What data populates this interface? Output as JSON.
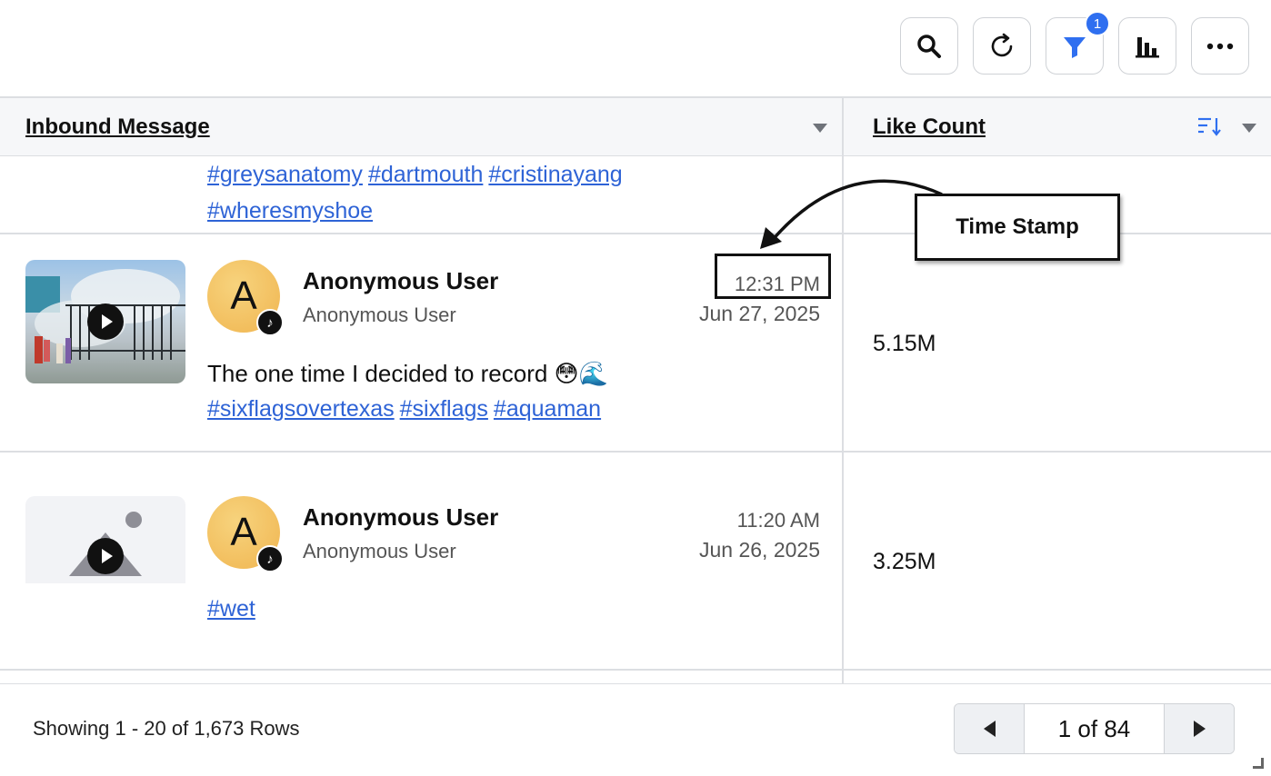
{
  "toolbar": {
    "filter_badge": "1",
    "buttons": [
      "search-icon",
      "refresh-icon",
      "filter-icon",
      "bar-chart-icon",
      "more-icon"
    ]
  },
  "columns": {
    "message": "Inbound Message",
    "likes": "Like Count"
  },
  "rows": [
    {
      "hashtags": [
        "#greysanatomy",
        "#dartmouth",
        "#cristinayang",
        "#wheresmyshoe"
      ]
    },
    {
      "avatar_letter": "A",
      "user_name": "Anonymous User",
      "user_handle": "Anonymous User",
      "time": "12:31 PM",
      "date": "Jun 27, 2025",
      "message": "The one time I decided to record 😳🌊",
      "hashtags": [
        "#sixflagsovertexas",
        "#sixflags",
        "#aquaman"
      ],
      "like_count": "5.15M"
    },
    {
      "avatar_letter": "A",
      "user_name": "Anonymous User",
      "user_handle": "Anonymous User",
      "time": "11:20 AM",
      "date": "Jun 26, 2025",
      "hashtags": [
        "#wet"
      ],
      "like_count": "3.25M"
    }
  ],
  "annotation": {
    "label": "Time Stamp"
  },
  "footer": {
    "showing": "Showing 1 - 20 of 1,673 Rows",
    "page": "1 of 84"
  },
  "colors": {
    "accent": "#2f6ff0",
    "link": "#2e63d6",
    "avatar": "#f0b550"
  }
}
